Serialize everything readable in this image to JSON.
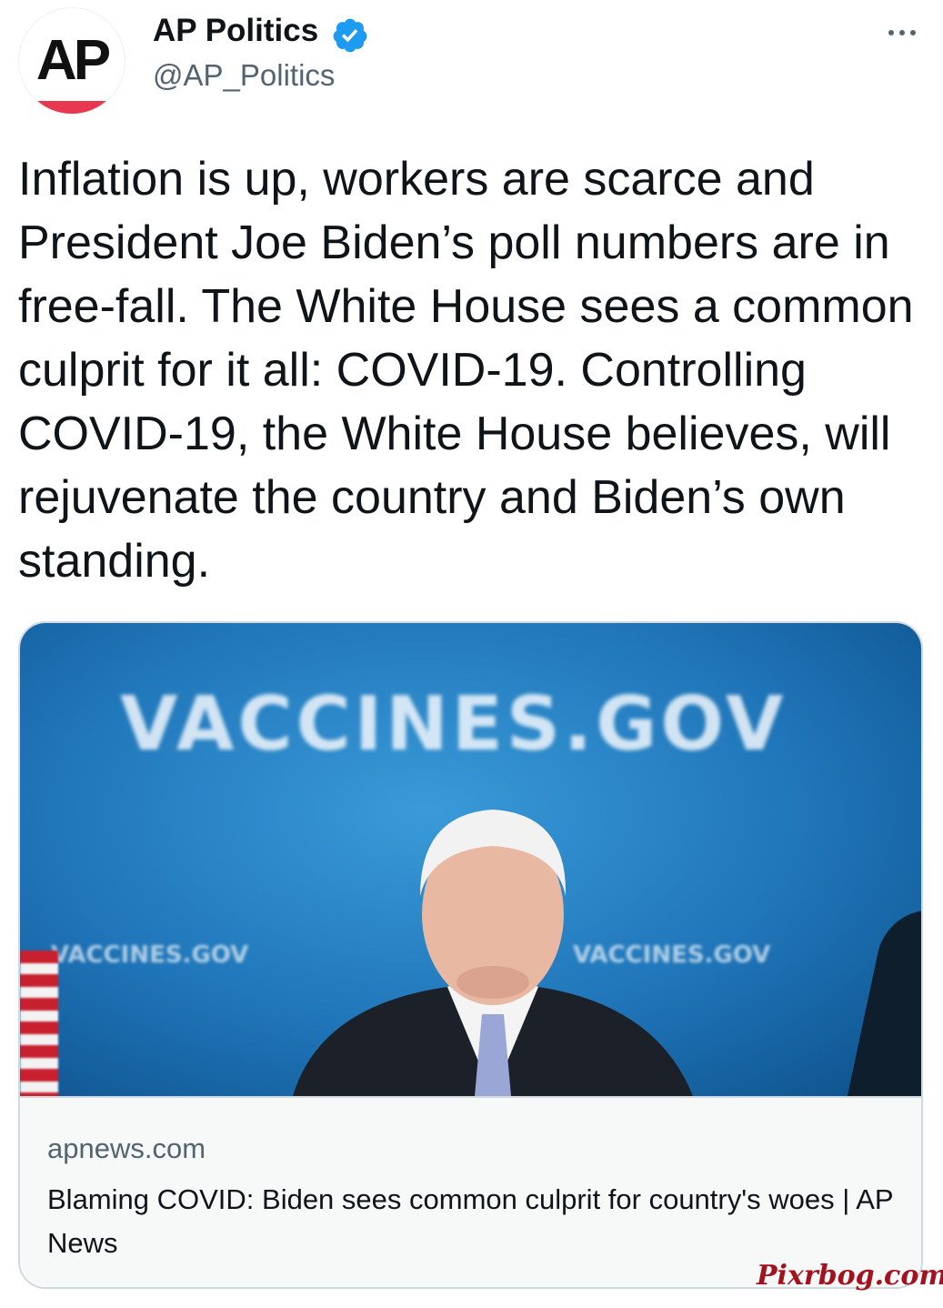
{
  "author": {
    "avatar_text": "AP",
    "display_name": "AP Politics",
    "handle": "@AP_Politics",
    "verified": true
  },
  "tweet": {
    "text": "Inflation is up, workers are scarce and President Joe Biden’s poll numbers are in free-fall. The White House sees a common culprit for it all: COVID-19. Controlling COVID-19, the White House believes, will rejuvenate the country and Biden’s own standing."
  },
  "card": {
    "image_sign_main": "VACCINES.GOV",
    "image_sign_left": "VACCINES.GOV",
    "image_sign_right": "VACCINES.GOV",
    "domain": "apnews.com",
    "title": "Blaming COVID: Biden sees common culprit for country's woes | AP News"
  },
  "watermark": "Pixrbog.com",
  "icons": {
    "verified": "verified-badge-icon",
    "more": "more-options-icon"
  },
  "colors": {
    "verified": "#1d9bf0",
    "secondary_text": "#536471",
    "ap_red": "#e8384f"
  }
}
